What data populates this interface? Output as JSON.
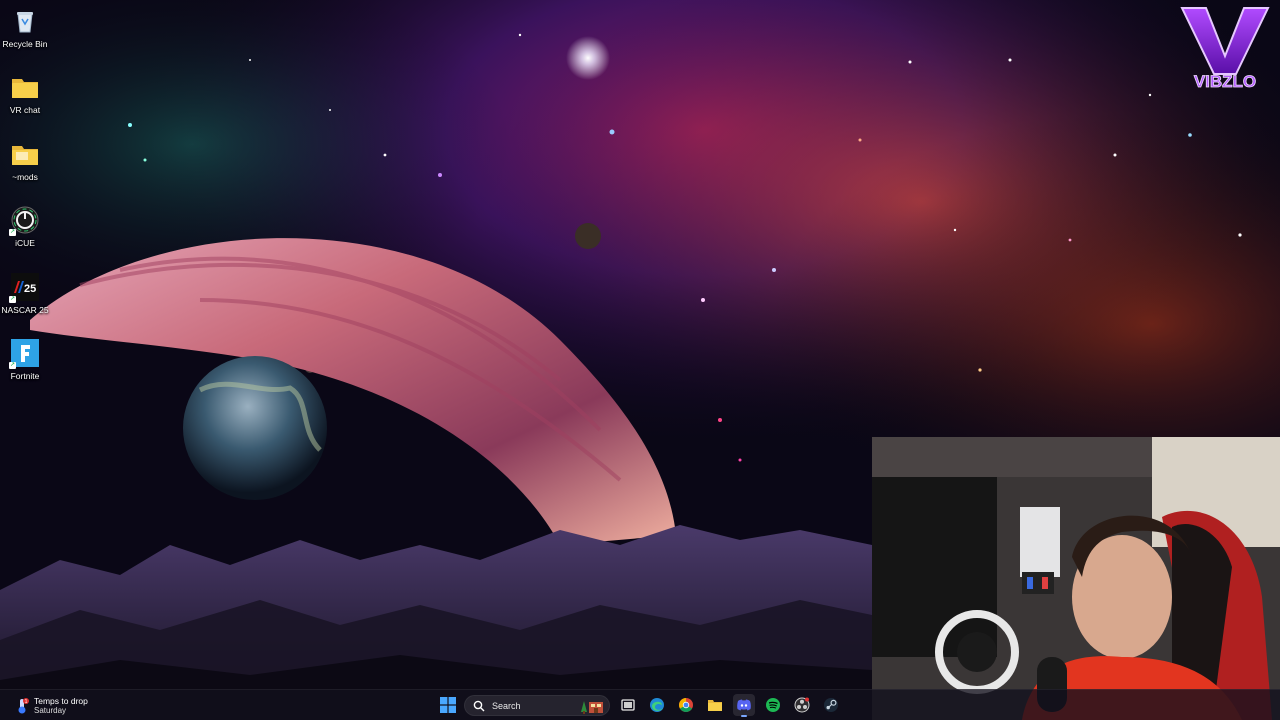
{
  "desktop_icons": [
    {
      "label": "Recycle Bin",
      "icon": "recycle-bin-icon"
    },
    {
      "label": "VR chat",
      "icon": "folder-icon"
    },
    {
      "label": "~mods",
      "icon": "folder-icon"
    },
    {
      "label": "iCUE",
      "icon": "icue-icon"
    },
    {
      "label": "NASCAR 25",
      "icon": "nascar-icon"
    },
    {
      "label": "Fortnite",
      "icon": "fortnite-icon"
    }
  ],
  "overlay_logo": {
    "letter": "V",
    "text": "VIBZLO"
  },
  "weather_widget": {
    "line1": "Temps to drop",
    "line2": "Saturday",
    "badge": "1"
  },
  "taskbar": {
    "search_placeholder": "Search",
    "pinned": [
      {
        "name": "start-button",
        "icon": "windows-start-icon"
      },
      {
        "name": "task-view-button",
        "icon": "task-view-icon"
      },
      {
        "name": "edge-button",
        "icon": "edge-icon"
      },
      {
        "name": "chrome-button",
        "icon": "chrome-icon"
      },
      {
        "name": "file-explorer-button",
        "icon": "folder-icon"
      },
      {
        "name": "discord-button",
        "icon": "discord-icon",
        "active": true
      },
      {
        "name": "spotify-button",
        "icon": "spotify-icon"
      },
      {
        "name": "obs-button",
        "icon": "obs-icon"
      },
      {
        "name": "steam-button",
        "icon": "steam-icon"
      }
    ]
  },
  "colors": {
    "taskbar_bg": "#12101c",
    "accent": "#7aa7ff",
    "logo_purple": "#8a2be2",
    "spotify": "#1db954",
    "discord": "#5865f2"
  }
}
